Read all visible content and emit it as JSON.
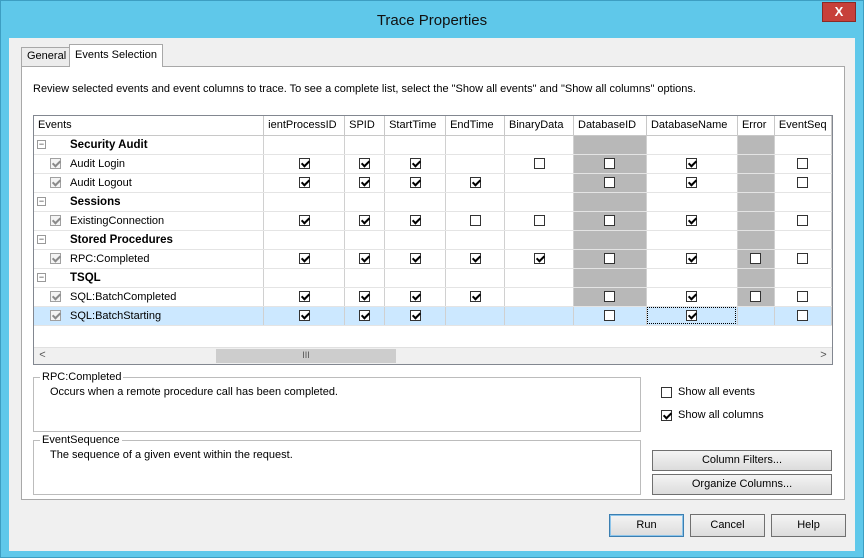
{
  "window": {
    "title": "Trace Properties",
    "close_label": "X"
  },
  "tabs": {
    "general": "General",
    "events_selection": "Events Selection"
  },
  "description": "Review selected events and event columns to trace. To see a complete list, select the \"Show all events\" and \"Show all columns\" options.",
  "grid": {
    "columns": [
      "Events",
      "ientProcessID",
      "SPID",
      "StartTime",
      "EndTime",
      "BinaryData",
      "DatabaseID",
      "DatabaseName",
      "Error",
      "EventSeq"
    ],
    "groups": [
      {
        "name": "Security Audit",
        "expander": "−",
        "events": [
          {
            "name": "Audit Login",
            "checks": [
              true,
              true,
              true,
              null,
              false,
              false,
              true,
              null,
              false
            ]
          },
          {
            "name": "Audit Logout",
            "checks": [
              true,
              true,
              true,
              true,
              null,
              false,
              true,
              null,
              false
            ]
          }
        ]
      },
      {
        "name": "Sessions",
        "expander": "−",
        "events": [
          {
            "name": "ExistingConnection",
            "checks": [
              true,
              true,
              true,
              false,
              false,
              false,
              true,
              null,
              false
            ]
          }
        ]
      },
      {
        "name": "Stored Procedures",
        "expander": "−",
        "events": [
          {
            "name": "RPC:Completed",
            "checks": [
              true,
              true,
              true,
              true,
              true,
              false,
              true,
              false,
              false
            ]
          }
        ]
      },
      {
        "name": "TSQL",
        "expander": "−",
        "events": [
          {
            "name": "SQL:BatchCompleted",
            "checks": [
              true,
              true,
              true,
              true,
              null,
              false,
              true,
              false,
              false
            ]
          },
          {
            "name": "SQL:BatchStarting",
            "checks": [
              true,
              true,
              true,
              null,
              null,
              false,
              true,
              null,
              false
            ],
            "selected": true
          }
        ]
      }
    ],
    "scroll_thumb_label": "III",
    "scroll_left": "<",
    "scroll_right": ">"
  },
  "event_info": {
    "caption": "RPC:Completed",
    "text": "Occurs when a remote procedure call has been completed."
  },
  "column_info": {
    "caption": "EventSequence",
    "text": "The sequence of a given event within the request."
  },
  "options": {
    "show_all_events": {
      "label": "Show all events",
      "checked": false
    },
    "show_all_columns": {
      "label": "Show all columns",
      "checked": true
    }
  },
  "buttons": {
    "column_filters": "Column Filters...",
    "organize_columns": "Organize Columns...",
    "run": "Run",
    "cancel": "Cancel",
    "help": "Help"
  }
}
